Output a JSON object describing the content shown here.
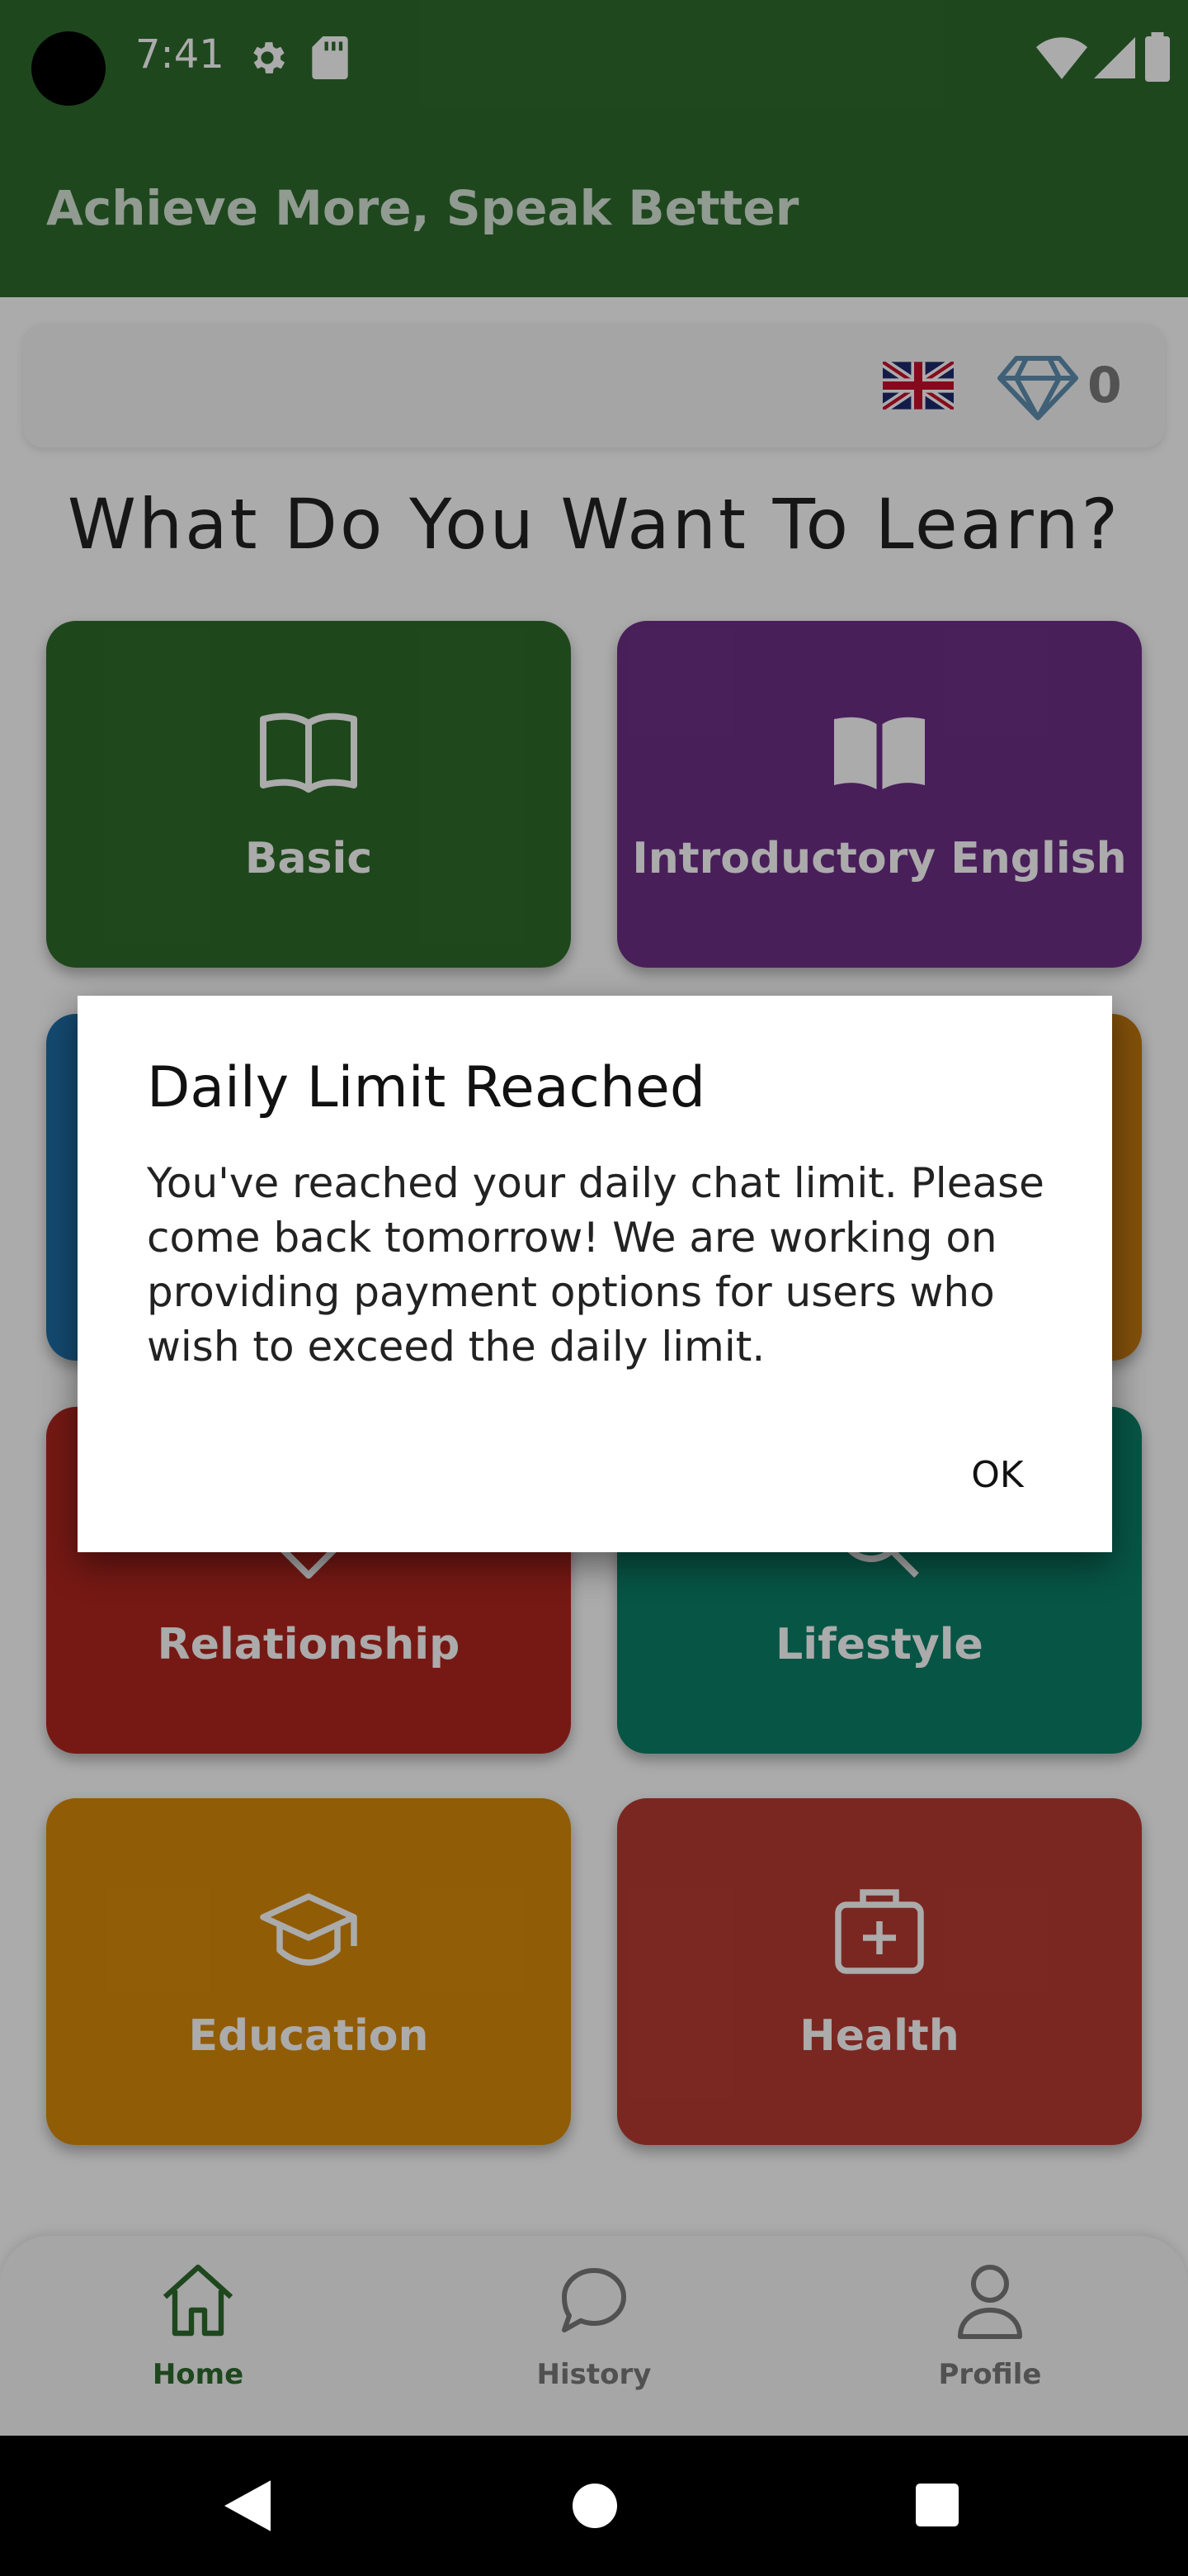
{
  "status_bar": {
    "time": "7:41"
  },
  "app_bar": {
    "title": "Achieve More, Speak Better"
  },
  "top_card": {
    "gem_count": "0"
  },
  "headline": "What Do You Want To Learn?",
  "topics": [
    {
      "label": "Basic",
      "color": "#2f6b2b",
      "icon": "book-open-outline-icon"
    },
    {
      "label": "Introductory English",
      "color": "#6d2f86",
      "icon": "book-open-filled-icon"
    },
    {
      "label": "",
      "color": "#1e6fa8",
      "icon": ""
    },
    {
      "label": "",
      "color": "#c2780f",
      "icon": ""
    },
    {
      "label": "Relationship",
      "color": "#b0261e",
      "icon": "heart-icon"
    },
    {
      "label": "Lifestyle",
      "color": "#0b7f68",
      "icon": "magnifier-icon"
    },
    {
      "label": "Education",
      "color": "#d88a09",
      "icon": "graduation-cap-icon"
    },
    {
      "label": "Health",
      "color": "#b83b32",
      "icon": "medical-kit-icon"
    }
  ],
  "bottom_nav": [
    {
      "label": "Home",
      "active": true,
      "icon": "home-icon"
    },
    {
      "label": "History",
      "active": false,
      "icon": "chat-bubble-icon"
    },
    {
      "label": "Profile",
      "active": false,
      "icon": "person-icon"
    }
  ],
  "dialog": {
    "title": "Daily Limit Reached",
    "body": "You've reached your daily chat limit. Please come back tomorrow! We are working on providing payment options for users who wish to exceed the daily limit.",
    "ok_label": "OK"
  },
  "colors": {
    "primary": "#2e6b2e",
    "scrim": "rgba(0,0,0,0.33)"
  }
}
